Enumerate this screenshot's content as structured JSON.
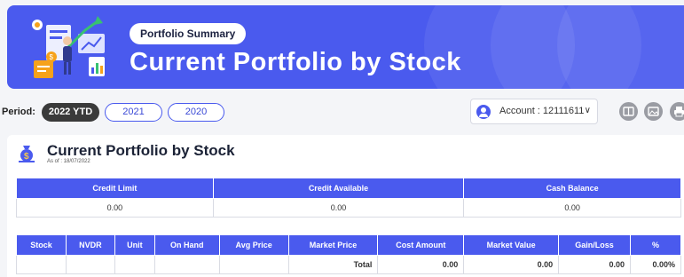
{
  "header": {
    "pill_label": "Portfolio Summary",
    "title": "Current Portfolio by Stock"
  },
  "period": {
    "label": "Period:",
    "options": [
      "2022 YTD",
      "2021",
      "2020"
    ],
    "selected": "2022 YTD"
  },
  "account": {
    "label": "Account : 12111611",
    "chevron": "∨"
  },
  "tools": [
    "excel-icon",
    "image-icon",
    "print-icon"
  ],
  "card": {
    "title": "Current Portfolio by Stock",
    "as_of": "As of : 18/07/2022"
  },
  "summary_table": {
    "headers": [
      "Credit Limit",
      "Credit Available",
      "Cash Balance"
    ],
    "values": [
      "0.00",
      "0.00",
      "0.00"
    ]
  },
  "stock_table": {
    "headers": [
      "Stock",
      "NVDR",
      "Unit",
      "On Hand",
      "Avg Price",
      "Market Price",
      "Cost Amount",
      "Market Value",
      "Gain/Loss",
      "%"
    ],
    "total_label": "Total",
    "totals": {
      "cost_amount": "0.00",
      "market_value": "0.00",
      "gain_loss": "0.00",
      "percent": "0.00%"
    }
  },
  "colors": {
    "accent": "#4a5aee",
    "dark_pill": "#3a3a3a"
  }
}
